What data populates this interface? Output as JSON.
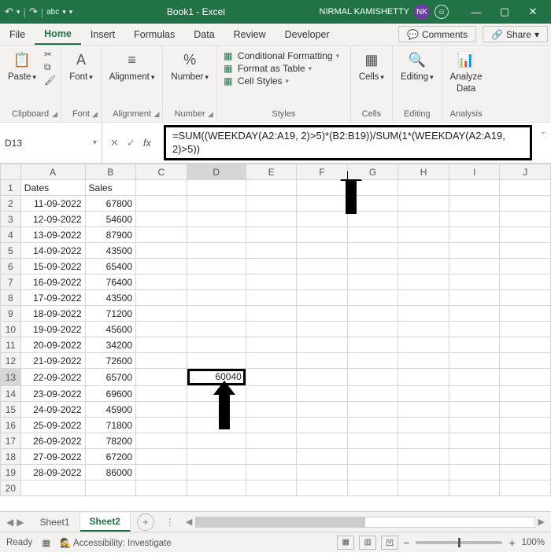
{
  "titlebar": {
    "title": "Book1 - Excel",
    "user_name": "NIRMAL KAMISHETTY",
    "user_initials": "NK"
  },
  "tabs": {
    "file": "File",
    "home": "Home",
    "insert": "Insert",
    "formulas": "Formulas",
    "data": "Data",
    "review": "Review",
    "developer": "Developer",
    "comments": "Comments",
    "share": "Share"
  },
  "ribbon": {
    "clipboard": {
      "paste": "Paste",
      "label": "Clipboard"
    },
    "font": {
      "btn": "Font",
      "label": "Font"
    },
    "alignment": {
      "btn": "Alignment",
      "label": "Alignment"
    },
    "number": {
      "btn": "Number",
      "label": "Number"
    },
    "styles": {
      "cond": "Conditional Formatting",
      "table": "Format as Table",
      "cell": "Cell Styles",
      "label": "Styles"
    },
    "cells": {
      "btn": "Cells",
      "label": "Cells"
    },
    "editing": {
      "btn": "Editing",
      "label": "Editing"
    },
    "analysis": {
      "btn": "Analyze Data",
      "label": "Analysis",
      "btn1": "Analyze",
      "btn2": "Data"
    }
  },
  "namebox": "D13",
  "formula": "=SUM((WEEKDAY(A2:A19, 2)>5)*(B2:B19))/SUM(1*(WEEKDAY(A2:A19, 2)>5))",
  "headers": {
    "a": "Dates",
    "b": "Sales"
  },
  "rows": [
    {
      "a": "11-09-2022",
      "b": "67800"
    },
    {
      "a": "12-09-2022",
      "b": "54600"
    },
    {
      "a": "13-09-2022",
      "b": "87900"
    },
    {
      "a": "14-09-2022",
      "b": "43500"
    },
    {
      "a": "15-09-2022",
      "b": "65400"
    },
    {
      "a": "16-09-2022",
      "b": "76400"
    },
    {
      "a": "17-09-2022",
      "b": "43500"
    },
    {
      "a": "18-09-2022",
      "b": "71200"
    },
    {
      "a": "19-09-2022",
      "b": "45600"
    },
    {
      "a": "20-09-2022",
      "b": "34200"
    },
    {
      "a": "21-09-2022",
      "b": "72600"
    },
    {
      "a": "22-09-2022",
      "b": "65700"
    },
    {
      "a": "23-09-2022",
      "b": "69600"
    },
    {
      "a": "24-09-2022",
      "b": "45900"
    },
    {
      "a": "25-09-2022",
      "b": "71800"
    },
    {
      "a": "26-09-2022",
      "b": "78200"
    },
    {
      "a": "27-09-2022",
      "b": "67200"
    },
    {
      "a": "28-09-2022",
      "b": "86000"
    }
  ],
  "d13": "60040",
  "sheets": {
    "s1": "Sheet1",
    "s2": "Sheet2"
  },
  "status": {
    "ready": "Ready",
    "access": "Accessibility: Investigate",
    "zoom": "100%"
  }
}
